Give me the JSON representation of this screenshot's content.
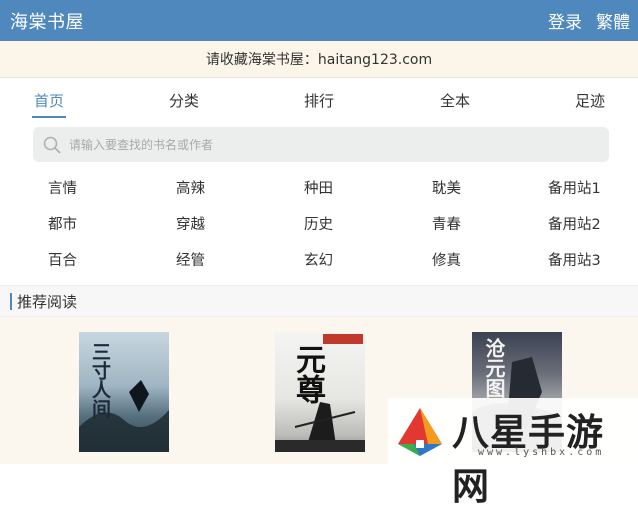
{
  "header": {
    "site_title": "海棠书屋",
    "login_label": "登录",
    "traditional_label": "繁體"
  },
  "notice": {
    "text": "请收藏海棠书屋：haitang123.com"
  },
  "nav": {
    "items": [
      "首页",
      "分类",
      "排行",
      "全本",
      "足迹"
    ],
    "active_index": 0
  },
  "search": {
    "placeholder": "请输入要查找的书名或作者",
    "icon": "search-icon"
  },
  "categories": [
    [
      "言情",
      "高辣",
      "种田",
      "耽美",
      "备用站1"
    ],
    [
      "都市",
      "穿越",
      "历史",
      "青春",
      "备用站2"
    ],
    [
      "百合",
      "经管",
      "玄幻",
      "修真",
      "备用站3"
    ]
  ],
  "section": {
    "title": "推荐阅读"
  },
  "books": [
    {
      "cover_text": "三寸人间"
    },
    {
      "cover_text": "元尊"
    },
    {
      "cover_text": "沧元图"
    }
  ],
  "watermark": {
    "text": "八星手游网",
    "url": "www.lyshbx.com"
  },
  "colors": {
    "brand": "#4e88bd",
    "notice_bg": "#fbf5ea",
    "books_bg": "#fcf7ee"
  }
}
